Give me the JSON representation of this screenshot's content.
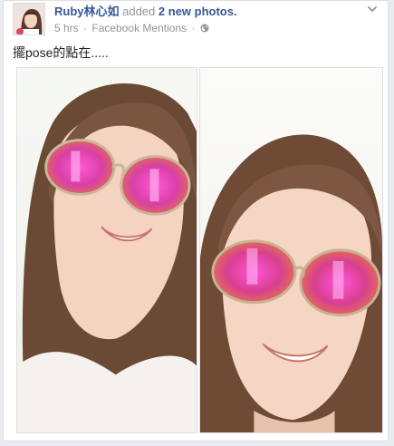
{
  "post": {
    "author": "Ruby林心如",
    "action_prefix": "added",
    "photo_count_text": "2 new photos.",
    "time": "5 hrs",
    "separator": "·",
    "source": "Facebook Mentions",
    "text": "擺pose的點在.....",
    "privacy_icon": "globe-icon",
    "menu_icon": "chevron-down-icon"
  },
  "photos": [
    {
      "id": "photo-1",
      "subject": "selfie-with-mirrored-aviator-sunglasses"
    },
    {
      "id": "photo-2",
      "subject": "selfie-smiling-with-mirrored-aviator-sunglasses"
    }
  ],
  "colors": {
    "link": "#365899",
    "text": "#1d2129",
    "meta": "#90949c",
    "border": "#dddfe2",
    "page_background": "#e9ebee",
    "lens_pink": "#e53fd0"
  }
}
